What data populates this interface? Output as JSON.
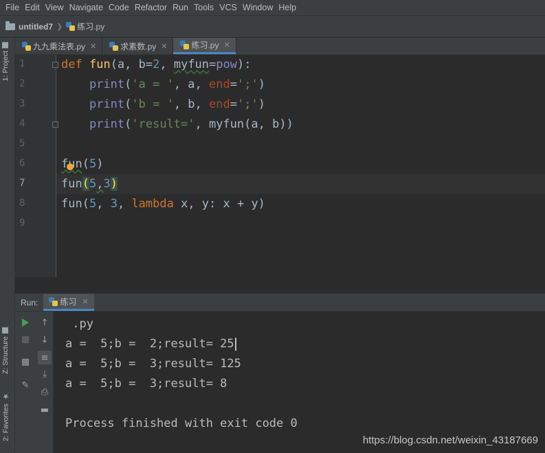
{
  "menu": [
    "File",
    "Edit",
    "View",
    "Navigate",
    "Code",
    "Refactor",
    "Run",
    "Tools",
    "VCS",
    "Window",
    "Help"
  ],
  "breadcrumb": {
    "project": "untitled7",
    "file": "练习.py"
  },
  "left_strip": {
    "project_tab": "1: Project",
    "structure_tab": "Z: Structure",
    "favorites_tab": "2: Favorites"
  },
  "tabs": [
    {
      "label": "九九乘法表.py",
      "active": false
    },
    {
      "label": "求素数.py",
      "active": false
    },
    {
      "label": "练习.py",
      "active": true
    }
  ],
  "close_glyph": "✕",
  "line_numbers": [
    "1",
    "2",
    "3",
    "4",
    "5",
    "6",
    "7",
    "8",
    "9"
  ],
  "code": {
    "l1": {
      "kw": "def",
      "sp": " ",
      "name": "fun",
      "open": "(a, b=",
      "num": "2",
      "mid": ", ",
      "param": "myfun",
      "eq": "=",
      "builtin": "pow",
      "close": "):"
    },
    "l2": {
      "indent": "    ",
      "builtin": "print",
      "open": "(",
      "str": "'a = '",
      "mid": ", a, ",
      "param": "end",
      "eq": "=",
      "str2": "';'",
      "close": ")"
    },
    "l3": {
      "indent": "    ",
      "builtin": "print",
      "open": "(",
      "str": "'b = '",
      "mid": ", b, ",
      "param": "end",
      "eq": "=",
      "str2": "';'",
      "close": ")"
    },
    "l4": {
      "indent": "    ",
      "builtin": "print",
      "open": "(",
      "str": "'result='",
      "rest": ", myfun(a, b))"
    },
    "l6": {
      "name": "fun",
      "open": "(",
      "num": "5",
      "close": ")"
    },
    "l7": {
      "name": "fun",
      "open": "(",
      "num1": "5",
      "comma": ",",
      "num2": "3",
      "close": ")"
    },
    "l8": {
      "name": "fun",
      "open": "(",
      "num1": "5",
      "c1": ", ",
      "num2": "3",
      "c2": ", ",
      "kw": "lambda",
      "rest": " x, y: x + y)"
    }
  },
  "run": {
    "label": "Run:",
    "tab": "练习",
    "output": [
      " .py",
      "a =  5;b =  2;result= 25",
      "a =  5;b =  3;result= 125",
      "a =  5;b =  3;result= 8",
      "",
      "Process finished with exit code 0"
    ]
  },
  "watermark": "https://blog.csdn.net/weixin_43187669",
  "colors": {
    "keyword": "#cc7832",
    "function": "#ffc66d",
    "number": "#6897bb",
    "string": "#6a8759",
    "builtin": "#8888c6",
    "param": "#aa4926",
    "active_tab_underline": "#4a88c7",
    "run_green": "#499c54"
  }
}
